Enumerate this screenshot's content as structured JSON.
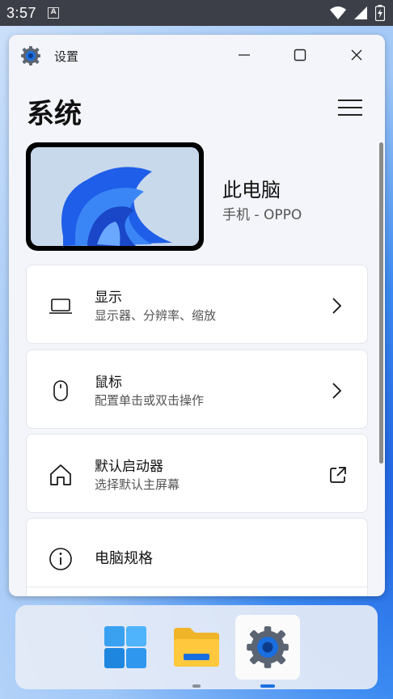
{
  "status_bar": {
    "time": "3:57",
    "notif_icon": "a-icon"
  },
  "window": {
    "title": "设置",
    "page_title": "系统",
    "device": {
      "name": "此电脑",
      "subtitle": "手机 - OPPO"
    },
    "cards": [
      {
        "label": "显示",
        "sub": "显示器、分辨率、缩放",
        "icon": "laptop-icon",
        "action": "chevron-right-icon"
      },
      {
        "label": "鼠标",
        "sub": "配置单击或双击操作",
        "icon": "mouse-icon",
        "action": "chevron-right-icon"
      },
      {
        "label": "默认启动器",
        "sub": "选择默认主屏幕",
        "icon": "home-icon",
        "action": "external-link-icon"
      },
      {
        "label": "电脑规格",
        "icon": "info-icon"
      }
    ]
  },
  "taskbar": {
    "items": [
      "start-icon",
      "file-explorer-icon",
      "settings-icon"
    ],
    "active": "settings-icon"
  },
  "colors": {
    "accent": "#1a6fe0",
    "window_bg": "#f3f5fa",
    "statusbar": "#3c3f47"
  }
}
